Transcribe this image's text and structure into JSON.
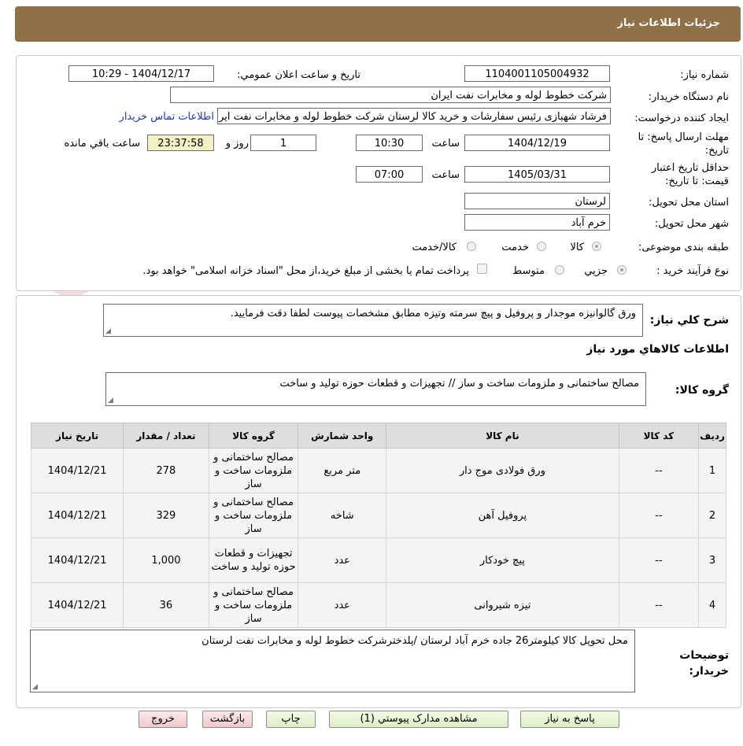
{
  "header": {
    "title": "جزئیات اطلاعات نیاز"
  },
  "form": {
    "need_number_label": "شماره نیاز:",
    "need_number": "1104001105004932",
    "announce_label": "تاریخ و ساعت اعلان عمومي:",
    "announce_value": "1404/12/17 - 10:29",
    "buyer_org_label": "نام دستگاه خريدار:",
    "buyer_org": "شرکت خطوط لوله و مخابرات نفت ايران",
    "requester_label": "ايجاد کننده درخواست:",
    "requester": "فرشاد شهبازی رئیس سفارشات و خرید کالا لرستان شرکت خطوط لوله و مخابرات نفت ایران",
    "contact_link": "اطلاعات تماس خريدار",
    "deadline_label": "مهلت ارسال پاسخ: تا تاريخ:",
    "deadline_date": "1404/12/19",
    "time_label": "ساعت",
    "deadline_time": "10:30",
    "days_value": "1",
    "days_label": "روز و",
    "remaining_value": "23:37:58",
    "remaining_label": "ساعت باقي مانده",
    "validity_label": "حداقل تاريخ اعتبار قيمت: تا تاريخ:",
    "validity_date": "1405/03/31",
    "validity_time": "07:00",
    "province_label": "استان محل تحويل:",
    "province": "لرستان",
    "city_label": "شهر محل تحويل:",
    "city": "خرم آباد",
    "category_label": "طبقه بندی موضوعی:",
    "category_options": [
      "کالا",
      "خدمت",
      "کالا/خدمت"
    ],
    "process_label": "نوع فرآيند خريد :",
    "process_options": [
      "جزيي",
      "متوسط"
    ],
    "payment_note": "پرداخت تمام يا بخشی از مبلغ خريد،از محل \"اسناد خزانه اسلامی\" خواهد بود."
  },
  "summary": {
    "desc_label": "شرح کلي نياز:",
    "desc_value": "ورق گالوانیزه موجدار و پروفیل و پیچ سرمته  وتیزه مطابق مشخصات پیوست لطفا دقت فرمایید.",
    "items_title": "اطلاعات کالاهاي مورد نياز",
    "group_label": "گروه کالا:",
    "group_value": "مصالح ساختمانی و ملزومات ساخت و ساز // تجهیزات و قطعات حوزه تولید و ساخت"
  },
  "table": {
    "headers": [
      "رديف",
      "کد کالا",
      "نام کالا",
      "واحد شمارش",
      "گروه کالا",
      "تعداد / مقدار",
      "تاريخ نياز"
    ],
    "rows": [
      [
        "1",
        "--",
        "ورق فولادی موج دار",
        "متر مربع",
        "مصالح ساختمانی و ملزومات ساخت و ساز",
        "278",
        "1404/12/21"
      ],
      [
        "2",
        "--",
        "پروفیل آهن",
        "شاخه",
        "مصالح ساختمانی و ملزومات ساخت و ساز",
        "329",
        "1404/12/21"
      ],
      [
        "3",
        "--",
        "پیچ خودکار",
        "عدد",
        "تجهیزات و قطعات حوزه تولید و ساخت",
        "1,000",
        "1404/12/21"
      ],
      [
        "4",
        "--",
        "تیزه شیروانی",
        "عدد",
        "مصالح ساختمانی و ملزومات ساخت و ساز",
        "36",
        "1404/12/21"
      ]
    ]
  },
  "notes": {
    "label": "توضيحات خريدار:",
    "value": "محل تحویل کالا کیلومتر26 جاده خرم آباد لرستان /پلدخترشرکت خطوط لوله و مخابرات نفت لرستان"
  },
  "buttons": {
    "reply": "پاسخ به نياز",
    "docs": "مشاهده مدارک پيوستي (1)",
    "print": "چاپ",
    "back": "بازگشت",
    "exit": "خروج"
  },
  "watermark": {
    "text": "AriaTender.net"
  }
}
